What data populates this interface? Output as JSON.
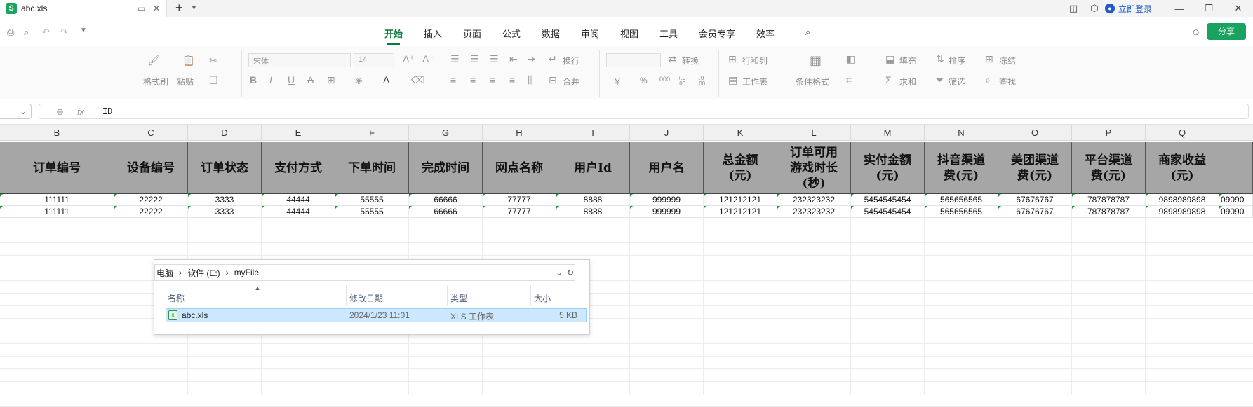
{
  "titlebar": {
    "tab_title": "abc.xls",
    "new_tab": "+",
    "login": "立即登录"
  },
  "menu": {
    "items": [
      "开始",
      "插入",
      "页面",
      "公式",
      "数据",
      "审阅",
      "视图",
      "工具",
      "会员专享",
      "效率"
    ],
    "active": "开始",
    "share": "分享"
  },
  "ribbon": {
    "format_painter": "格式刷",
    "paste": "粘贴",
    "font_name": "宋体",
    "font_size": "14",
    "wrap": "换行",
    "merge": "合并",
    "convert": "转换",
    "rows_cols": "行和列",
    "worksheet": "工作表",
    "cond_format": "条件格式",
    "fill": "填充",
    "sort": "排序",
    "freeze": "冻结",
    "sum": "求和",
    "filter": "筛选",
    "find": "查找",
    "currency": "￥",
    "percent": "%",
    "thousands": "000",
    "dec_inc": "+.0 .00",
    "dec_dec": "-.0 .00"
  },
  "formula_bar": {
    "fx": "fx",
    "value": "ID"
  },
  "columns": [
    "B",
    "C",
    "D",
    "E",
    "F",
    "G",
    "H",
    "I",
    "J",
    "K",
    "L",
    "M",
    "N",
    "O",
    "P",
    "Q"
  ],
  "headers": [
    "订单编号",
    "设备编号",
    "订单状态",
    "支付方式",
    "下单时间",
    "完成时间",
    "网点名称",
    "用户Id",
    "用户名",
    "总金额\n(元)",
    "订单可用\n游戏时长\n(秒)",
    "实付金额\n(元)",
    "抖音渠道\n费(元)",
    "美团渠道\n费(元)",
    "平台渠道\n费(元)",
    "商家收益\n(元)"
  ],
  "rows": [
    [
      "111111",
      "22222",
      "3333",
      "44444",
      "55555",
      "66666",
      "77777",
      "8888",
      "999999",
      "121212121",
      "232323232",
      "5454545454",
      "565656565",
      "67676767",
      "787878787",
      "9898989898",
      "09090"
    ],
    [
      "111111",
      "22222",
      "3333",
      "44444",
      "55555",
      "66666",
      "77777",
      "8888",
      "999999",
      "121212121",
      "232323232",
      "5454545454",
      "565656565",
      "67676767",
      "787878787",
      "9898989898",
      "09090"
    ]
  ],
  "explorer": {
    "breadcrumb": [
      "电脑",
      "软件 (E:)",
      "myFile"
    ],
    "col_name": "名称",
    "col_date": "修改日期",
    "col_type": "类型",
    "col_size": "大小",
    "file": {
      "name": "abc.xls",
      "date": "2024/1/23 11:01",
      "type": "XLS 工作表",
      "size": "5 KB"
    }
  },
  "colors": {
    "accent": "#0a7a3a",
    "share": "#1aa260",
    "header_fill": "#a6a6a6",
    "selection": "#cce8ff"
  }
}
